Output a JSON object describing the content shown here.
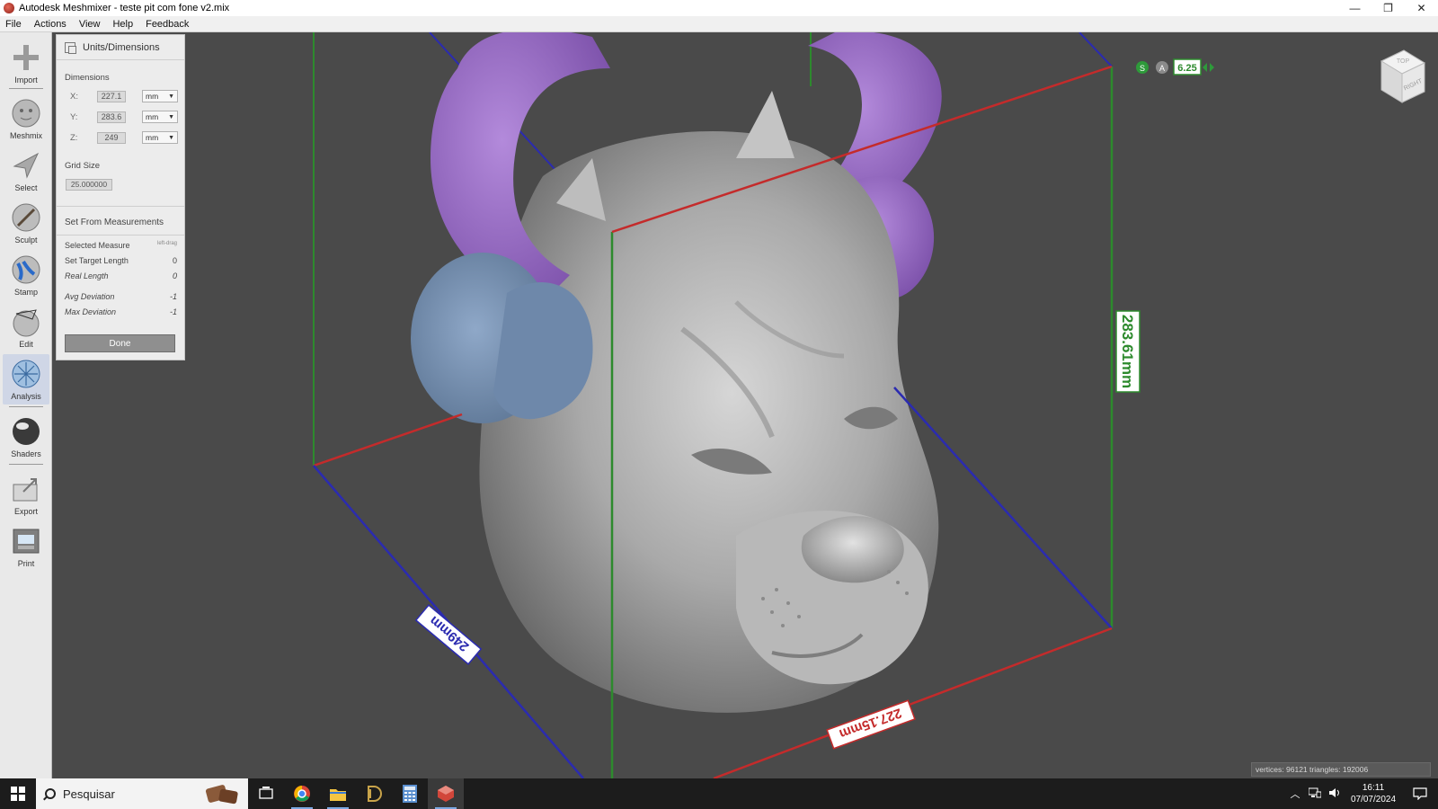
{
  "window": {
    "title": "Autodesk Meshmixer - teste pit com fone v2.mix",
    "minimize": "—",
    "restore": "❐",
    "close": "✕"
  },
  "menu": [
    "File",
    "Actions",
    "View",
    "Help",
    "Feedback"
  ],
  "tools": [
    {
      "label": "Import",
      "icon": "import-icon"
    },
    {
      "label": "Meshmix",
      "icon": "meshmix-icon"
    },
    {
      "label": "Select",
      "icon": "select-icon"
    },
    {
      "label": "Sculpt",
      "icon": "sculpt-icon"
    },
    {
      "label": "Stamp",
      "icon": "stamp-icon"
    },
    {
      "label": "Edit",
      "icon": "edit-icon"
    },
    {
      "label": "Analysis",
      "icon": "analysis-icon"
    },
    {
      "label": "Shaders",
      "icon": "shaders-icon"
    },
    {
      "label": "Export",
      "icon": "export-icon"
    },
    {
      "label": "Print",
      "icon": "print-icon"
    }
  ],
  "units_panel": {
    "title": "Units/Dimensions",
    "dimensions_label": "Dimensions",
    "x_label": "X:",
    "x_value": "227.1",
    "x_unit": "mm",
    "y_label": "Y:",
    "y_value": "283.6",
    "y_unit": "mm",
    "z_label": "Z:",
    "z_value": "249",
    "z_unit": "mm",
    "grid_size_label": "Grid Size",
    "grid_size_value": "25.000000",
    "set_from_label": "Set From Measurements",
    "selected_measure_label": "Selected Measure",
    "selected_measure_value": "left-drag",
    "set_target_label": "Set Target Length",
    "set_target_value": "0",
    "real_length_label": "Real Length",
    "real_length_value": "0",
    "avg_dev_label": "Avg Deviation",
    "avg_dev_value": "-1",
    "max_dev_label": "Max Deviation",
    "max_dev_value": "-1",
    "done_label": "Done"
  },
  "viewport": {
    "tag_x": "227.15mm",
    "tag_y": "283.61mm",
    "tag_z": "249mm",
    "snap_s": "S",
    "snap_a": "A",
    "grid_step": "6.25",
    "viewcube_label": "RIGHT",
    "viewcube_top": "TOP",
    "status": "vertices: 96121  triangles: 192006"
  },
  "colors": {
    "x_axis": "#c42b2b",
    "y_axis": "#2d8a2d",
    "z_axis": "#2b2bb0",
    "headphone_purple": "#9a6ec6",
    "headphone_blue": "#7592b5"
  },
  "taskbar": {
    "search_placeholder": "Pesquisar",
    "time": "16:11",
    "date": "07/07/2024"
  }
}
